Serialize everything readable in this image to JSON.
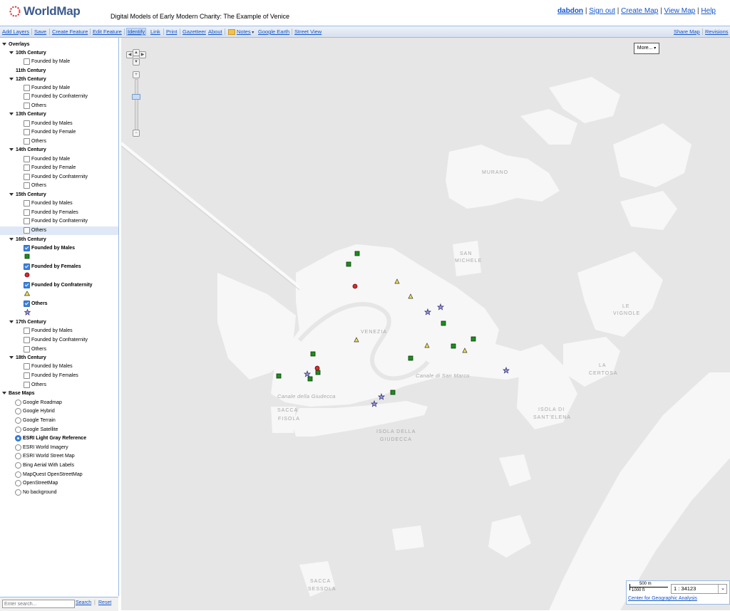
{
  "header": {
    "logo_text": "WorldMap",
    "map_title": "Digital Models of Early Modern Charity: The Example of Venice",
    "user": "dabdon",
    "nav": [
      "Sign out",
      "Create Map",
      "View Map",
      "Help"
    ]
  },
  "toolbar": {
    "left": [
      "Add Layers",
      "Save",
      "Create Feature",
      "Edit Feature",
      "Identify",
      "Link",
      "Print",
      "Gazetteer",
      "About",
      "Notes",
      "Google Earth",
      "Street View"
    ],
    "right": [
      "Share Map",
      "Revisions"
    ],
    "active": "Identify"
  },
  "sidebar": {
    "overlays_label": "Overlays",
    "groups": [
      {
        "title": "10th Century",
        "items": [
          {
            "label": "Founded by Male",
            "checked": false
          }
        ]
      },
      {
        "title": "11th Century",
        "items": []
      },
      {
        "title": "12th Century",
        "items": [
          {
            "label": "Founded by Male",
            "checked": false
          },
          {
            "label": "Founded by Confraternity",
            "checked": false
          },
          {
            "label": "Others",
            "checked": false
          }
        ]
      },
      {
        "title": "13th Century",
        "items": [
          {
            "label": "Founded by Males",
            "checked": false
          },
          {
            "label": "Founded by Female",
            "checked": false
          },
          {
            "label": "Others",
            "checked": false
          }
        ]
      },
      {
        "title": "14th Century",
        "items": [
          {
            "label": "Founded by Male",
            "checked": false
          },
          {
            "label": "Founded by Female",
            "checked": false
          },
          {
            "label": "Founded by Confraternity",
            "checked": false
          },
          {
            "label": "Others",
            "checked": false
          }
        ]
      },
      {
        "title": "15th Century",
        "items": [
          {
            "label": "Founded by Males",
            "checked": false
          },
          {
            "label": "Founded by Females",
            "checked": false
          },
          {
            "label": "Founded by Confraternity",
            "checked": false
          },
          {
            "label": "Others",
            "checked": false,
            "highlight": true
          }
        ]
      },
      {
        "title": "16th Century",
        "items": [
          {
            "label": "Founded by Males",
            "checked": true,
            "symbol": "square"
          },
          {
            "label": "Founded by Females",
            "checked": true,
            "symbol": "circle"
          },
          {
            "label": "Founded by Confraternity",
            "checked": true,
            "symbol": "triangle"
          },
          {
            "label": "Others",
            "checked": true,
            "symbol": "star"
          }
        ]
      },
      {
        "title": "17th Century",
        "items": [
          {
            "label": "Founded by Males",
            "checked": false
          },
          {
            "label": "Founded by Confraternity",
            "checked": false
          },
          {
            "label": "Others",
            "checked": false
          }
        ]
      },
      {
        "title": "18th Century",
        "items": [
          {
            "label": "Founded by Males",
            "checked": false
          },
          {
            "label": "Founded by Females",
            "checked": false
          },
          {
            "label": "Others",
            "checked": false
          }
        ]
      }
    ],
    "basemaps_label": "Base Maps",
    "basemaps": [
      "Google Roadmap",
      "Google Hybrid",
      "Google Terrain",
      "Google Satellite",
      "ESRI Light Gray Reference",
      "ESRI World Imagery",
      "ESRI World Street Map",
      "Bing Aerial With Labels",
      "MapQuest OpenStreetMap",
      "OpenStreetMap",
      "No background"
    ],
    "basemap_selected": "ESRI Light Gray Reference",
    "search_placeholder": "Enter search...",
    "search_button": "Search",
    "reset_button": "Reset"
  },
  "map": {
    "more_button": "More...",
    "labels": {
      "murano": "MURANO",
      "san_michele_1": "SAN",
      "san_michele_2": "MICHELE",
      "venezia": "VENEZIA",
      "le_vignole_1": "LE",
      "le_vignole_2": "VIGNOLE",
      "la_certosa_1": "LA",
      "la_certosa_2": "CERTOSA",
      "canale_san_marco": "Canale di San Marco",
      "canale_giudecca": "Canale della Giudecca",
      "sacca_fisola_1": "SACCA",
      "sacca_fisola_2": "FISOLA",
      "isola_giudecca_1": "ISOLA DELLA",
      "isola_giudecca_2": "GIUDECCA",
      "isola_santelena_1": "ISOLA DI",
      "isola_santelena_2": "SANT'ELENA",
      "sacca_sessola_1": "SACCA",
      "sacca_sessola_2": "SESSOLA"
    },
    "scale": {
      "metric": "500 m",
      "imperial": "1000 ft",
      "ratio": "1 : 34123"
    },
    "attribution": "Center for Geographic Analysis",
    "colors": {
      "males": "#1e8c1e",
      "females": "#e0282d",
      "confraternity": "#f0e050",
      "others": "#4a4aa8"
    }
  }
}
